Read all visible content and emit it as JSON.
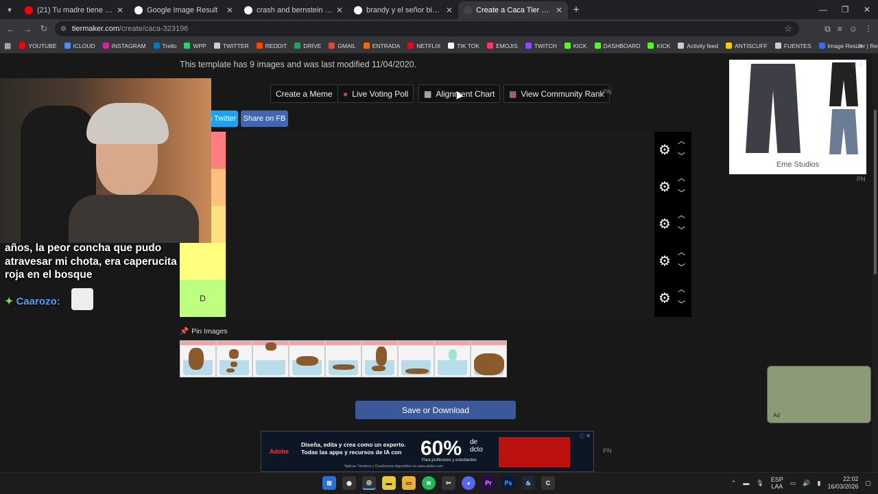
{
  "browser": {
    "tabs": [
      {
        "title": "(21) Tu madre tiene una polla -",
        "favicon_color": "#ff0000",
        "active": false
      },
      {
        "title": "Google Image Result",
        "favicon_color": "#ffffff",
        "active": false
      },
      {
        "title": "crash and bernstein - Buscar co",
        "favicon_color": "#ffffff",
        "active": false
      },
      {
        "title": "brandy y el señor bigotes - Busc",
        "favicon_color": "#ffffff",
        "active": false
      },
      {
        "title": "Create a Caca Tier List - TierMa",
        "favicon_color": "#444444",
        "active": true
      }
    ],
    "new_tab": "+",
    "url_host": "tiermaker.com",
    "url_path": "/create/caca-323196",
    "bookmarks": [
      {
        "label": "YOUTUBE",
        "color": "#ff0000"
      },
      {
        "label": "ICLOUD",
        "color": "#4c8df6"
      },
      {
        "label": "INSTAGRAM",
        "color": "#d6249f"
      },
      {
        "label": "Trello",
        "color": "#0079bf"
      },
      {
        "label": "WPP",
        "color": "#25d366"
      },
      {
        "label": "TWITTER",
        "color": "#cccccc"
      },
      {
        "label": "REDDIT",
        "color": "#ff4500"
      },
      {
        "label": "DRIVE",
        "color": "#1fa463"
      },
      {
        "label": "GMAIL",
        "color": "#ea4335"
      },
      {
        "label": "ENTRADA",
        "color": "#ff6600"
      },
      {
        "label": "NETFLIX",
        "color": "#e50914"
      },
      {
        "label": "TIK TOK",
        "color": "#ffffff"
      },
      {
        "label": "EMOJIS",
        "color": "#ff3366"
      },
      {
        "label": "TWITCH",
        "color": "#9146ff"
      },
      {
        "label": "KICK",
        "color": "#53fc18"
      },
      {
        "label": "DASHBOARD",
        "color": "#53fc18"
      },
      {
        "label": "KICK",
        "color": "#53fc18"
      },
      {
        "label": "Activity feed",
        "color": "#cccccc"
      },
      {
        "label": "ANTISCUFF",
        "color": "#ffcc00"
      },
      {
        "label": "FUENTES",
        "color": "#cccccc"
      },
      {
        "label": "Image Resizer | Resi...",
        "color": "#3a6ee8"
      }
    ]
  },
  "page": {
    "template_info": "This template has 9 images and was last modified 11/04/2020.",
    "create_meme": "Create a Meme",
    "live_voting": "Live Voting Poll",
    "alignment_chart": "Alignment Chart",
    "community_rank": "View Community Rank",
    "pn": "PN",
    "share_twitter": "Share on Twitter",
    "share_fb": "Share on FB",
    "tiers": [
      {
        "label": "",
        "color": "#ff7f7f"
      },
      {
        "label": "",
        "color": "#ffbf7f"
      },
      {
        "label": "",
        "color": "#ffdf7f"
      },
      {
        "label": "",
        "color": "#ffff7f"
      },
      {
        "label": "D",
        "color": "#bfff7f"
      }
    ],
    "pin_images": "Pin Images",
    "image_count": 9,
    "save_download": "Save or Download"
  },
  "ads": {
    "right_brand": "Eme Studios",
    "right_pn": "PN",
    "bottom_logo": "Adobe",
    "bottom_text1": "Diseña, edita y crea como un experto.",
    "bottom_text2": "Todas las apps y recursos de IA con",
    "bottom_small": "*Aplican Términos y Condiciones disponibles en www.adobe.com",
    "bottom_pct": "60%",
    "bottom_de": "de",
    "bottom_dcto": "dcto",
    "bottom_para": "Para profesores y estudiantes",
    "bottom_pn": "PN",
    "mini_label": "Ad"
  },
  "stream": {
    "caption": "años, la peor concha que pudo atravesar mi chota, era caperucita roja en el bosque",
    "chat_user": "Caarozo:"
  },
  "taskbar": {
    "lang1": "ESP",
    "lang2": "LAA",
    "time": "22:02",
    "date": "16/03/2026"
  }
}
